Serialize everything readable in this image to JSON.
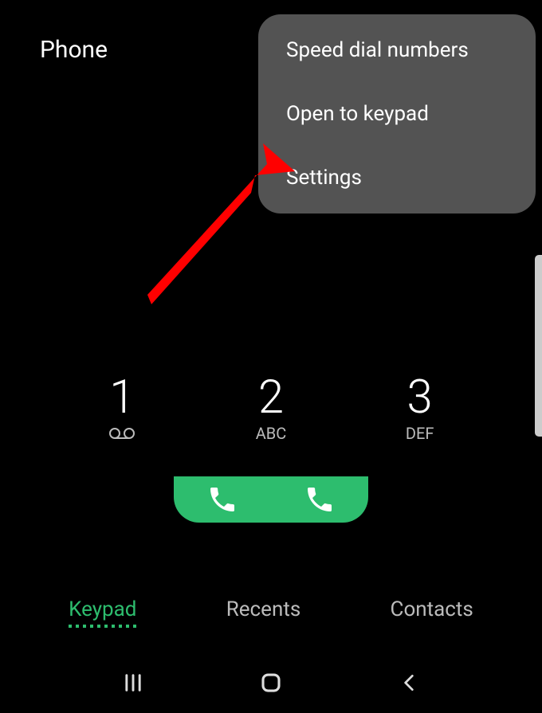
{
  "header": {
    "title": "Phone"
  },
  "menu": {
    "items": [
      "Speed dial numbers",
      "Open to keypad",
      "Settings"
    ]
  },
  "keypad": {
    "keys": [
      {
        "digit": "1",
        "letters": ""
      },
      {
        "digit": "2",
        "letters": "ABC"
      },
      {
        "digit": "3",
        "letters": "DEF"
      }
    ]
  },
  "tabs": {
    "items": [
      "Keypad",
      "Recents",
      "Contacts"
    ],
    "active": 0
  }
}
